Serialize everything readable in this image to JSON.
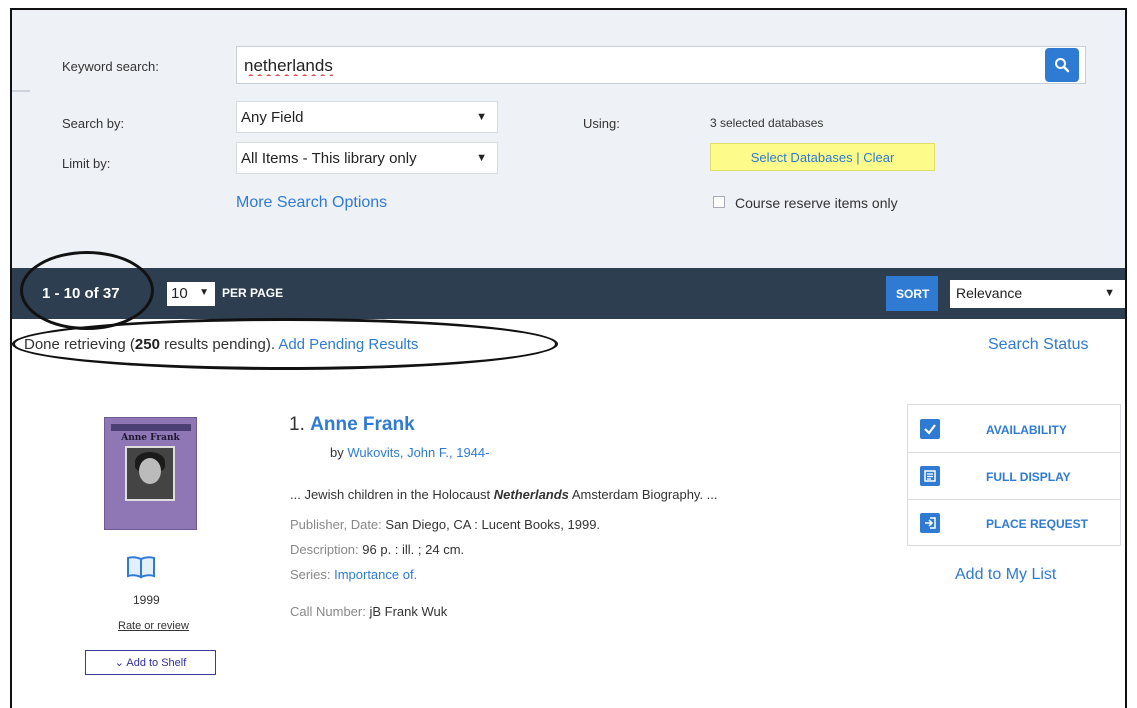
{
  "search": {
    "keyword_label": "Keyword search:",
    "keyword_value": "netherlands",
    "search_by_label": "Search by:",
    "search_by_value": "Any Field",
    "limit_by_label": "Limit by:",
    "limit_by_value": "All Items - This library only",
    "more_options": "More Search Options",
    "using_label": "Using:",
    "using_value": "3 selected databases",
    "select_databases": "Select Databases",
    "separator": "|",
    "clear": "Clear",
    "course_reserve": "Course reserve items only"
  },
  "results_bar": {
    "count": "1 - 10 of 37",
    "per_page_value": "10",
    "per_page_label": "PER PAGE",
    "sort_label": "SORT",
    "sort_value": "Relevance"
  },
  "status": {
    "prefix": "Done retrieving (",
    "pending_count": "250",
    "suffix": " results pending). ",
    "add_pending": "Add Pending Results",
    "search_status": "Search Status"
  },
  "result": {
    "number": "1.",
    "title": "Anne Frank",
    "by_prefix": "by",
    "author": "Wukovits, John F., 1944-",
    "snippet_pre": "... Jewish children in the Holocaust ",
    "snippet_em": "Netherlands",
    "snippet_post": " Amsterdam Biography. ...",
    "publisher_label": "Publisher, Date:",
    "publisher_value": "San Diego, CA : Lucent Books, 1999.",
    "description_label": "Description:",
    "description_value": "96 p. : ill. ; 24 cm.",
    "series_label": "Series:",
    "series_value": "Importance of.",
    "call_label": "Call Number:",
    "call_value": "jB Frank Wuk",
    "cover_title": "Anne Frank",
    "year": "1999",
    "rate_review": "Rate or review",
    "add_to_shelf": "Add to Shelf",
    "actions": {
      "availability": "AVAILABILITY",
      "full_display": "FULL DISPLAY",
      "place_request": "PLACE REQUEST"
    },
    "add_to_list": "Add to My List"
  },
  "colors": {
    "accent": "#2f7bd3",
    "bar": "#2d3e50",
    "highlight": "#fdfb8a",
    "panel": "#eef1f5"
  }
}
